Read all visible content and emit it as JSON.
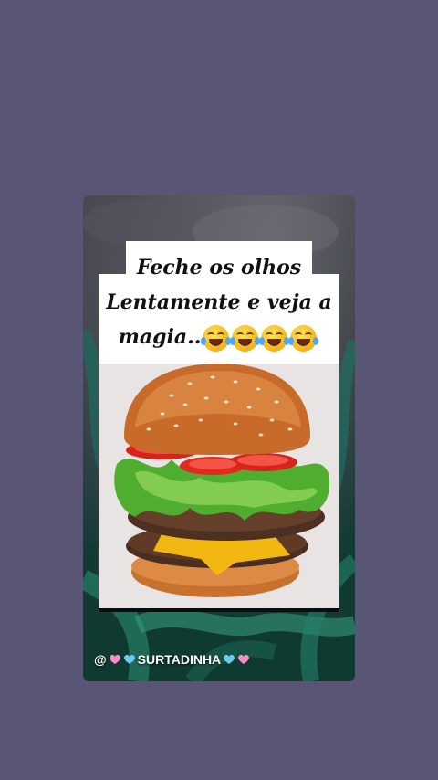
{
  "post": {
    "caption_line1": "Feche os olhos",
    "caption_line2": "Lentamente e veja a",
    "caption_line3": "magia..",
    "emoji_icons": [
      "laughing-tears-icon",
      "laughing-tears-icon",
      "laughing-tears-icon",
      "laughing-tears-icon"
    ],
    "image_subject": "burger-image",
    "username_prefix": "@",
    "username_name": "SURTADINHA",
    "heart_colors": [
      "#ff8cc6",
      "#6ccbf0"
    ]
  },
  "colors": {
    "page_background": "#585575",
    "caption_background": "#ffffff",
    "caption_text": "#111111",
    "image_background": "#e9e4e4"
  }
}
